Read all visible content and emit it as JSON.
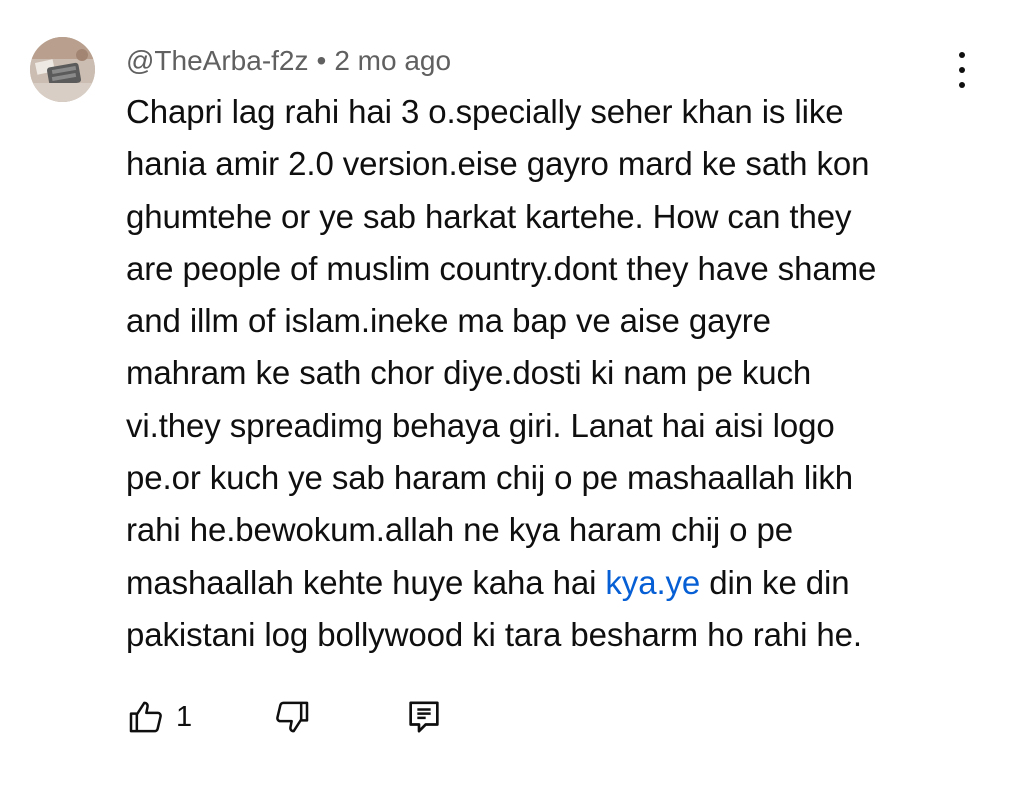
{
  "comment": {
    "author": "@TheArba-f2z",
    "separator": "•",
    "time_ago": "2 mo ago",
    "text_lines": [
      {
        "pre": "Chapri lag rahi hai 3 o.specially seher khan is like",
        "link": "",
        "post": ""
      },
      {
        "pre": "hania amir 2.0 version.eise gayro mard ke sath kon",
        "link": "",
        "post": ""
      },
      {
        "pre": "ghumtehe or ye sab harkat kartehe. How can they",
        "link": "",
        "post": ""
      },
      {
        "pre": "are people of muslim country.dont they have shame",
        "link": "",
        "post": ""
      },
      {
        "pre": "and illm of islam.ineke ma bap ve aise gayre",
        "link": "",
        "post": ""
      },
      {
        "pre": "mahram ke sath chor diye.dosti ki nam pe kuch",
        "link": "",
        "post": ""
      },
      {
        "pre": "vi.they spreadimg behaya giri. Lanat hai aisi logo",
        "link": "",
        "post": ""
      },
      {
        "pre": "pe.or kuch ye sab haram chij o pe mashaallah likh",
        "link": "",
        "post": ""
      },
      {
        "pre": "rahi he.bewokum.allah ne kya haram chij o pe",
        "link": "",
        "post": ""
      },
      {
        "pre": "mashaallah kehte huye kaha hai ",
        "link": "kya.ye",
        "post": " din ke din"
      },
      {
        "pre": "pakistani log bollywood ki tara besharm ho rahi he.",
        "link": "",
        "post": ""
      }
    ],
    "like_count": "1"
  },
  "icons": {
    "more": "more-vert-icon",
    "like": "thumbs-up-icon",
    "dislike": "thumbs-down-icon",
    "reply": "comment-reply-icon"
  },
  "colors": {
    "text": "#0f0f0f",
    "meta": "#606060",
    "link": "#065fd4",
    "background": "#ffffff"
  }
}
